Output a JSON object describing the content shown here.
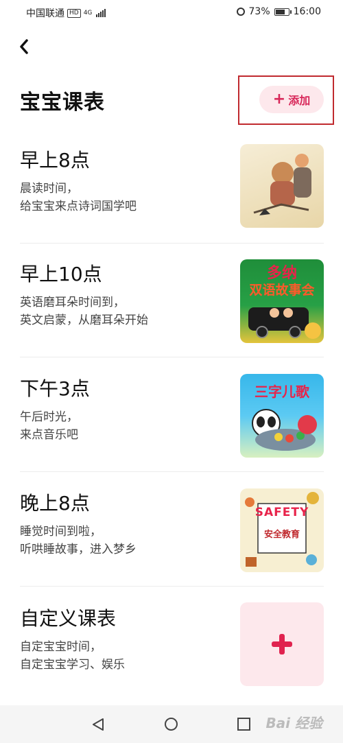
{
  "status_bar": {
    "carrier": "中国联通",
    "hd": "HD",
    "network": "4G",
    "battery": "73%",
    "time": "16:00"
  },
  "header": {
    "title": "宝宝课表",
    "add_icon": "plus-icon",
    "add_label": "添加"
  },
  "schedule": [
    {
      "time": "早上8点",
      "desc1": "晨读时间，",
      "desc2": "给宝宝来点诗词国学吧",
      "thumb": "classical-story-illustration"
    },
    {
      "time": "早上10点",
      "desc1": "英语磨耳朵时间到，",
      "desc2": "英文启蒙，从磨耳朵开始",
      "thumb": "bilingual-story-cover",
      "thumb_text": "多纳",
      "thumb_text2": "双语故事会"
    },
    {
      "time": "下午3点",
      "desc1": "午后时光，",
      "desc2": "来点音乐吧",
      "thumb": "nursery-rhyme-cover",
      "thumb_text": "三字儿歌"
    },
    {
      "time": "晚上8点",
      "desc1": "睡觉时间到啦，",
      "desc2": "听哄睡故事，进入梦乡",
      "thumb": "safety-education-cover",
      "thumb_text": "SAFETY",
      "thumb_text2": "安全教育"
    },
    {
      "time": "自定义课表",
      "desc1": "自定宝宝时间，",
      "desc2": "自定宝宝学习、娱乐",
      "thumb": "plus-icon"
    }
  ],
  "watermark": "Bai 经验",
  "colors": {
    "accent": "#d8285a",
    "accent_bg": "#fde8ec",
    "highlight_frame": "#c0292e"
  }
}
